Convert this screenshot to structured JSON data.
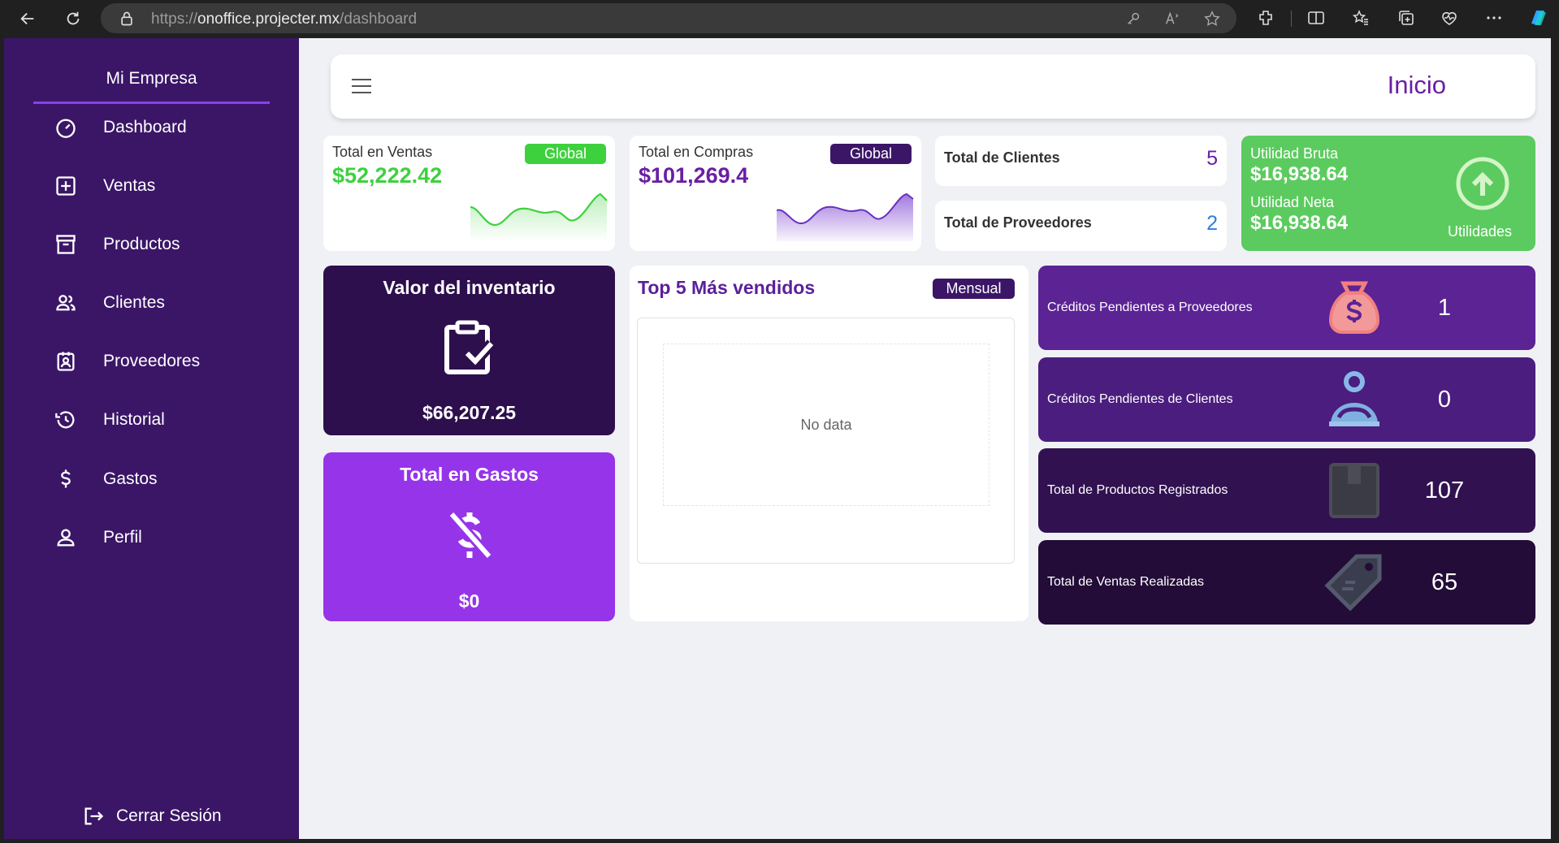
{
  "browser": {
    "url_scheme": "https://",
    "url_host": "onoffice.projecter.mx",
    "url_path": "/dashboard"
  },
  "sidebar": {
    "brand": "Mi Empresa",
    "items": [
      {
        "label": "Dashboard",
        "icon": "gauge-icon"
      },
      {
        "label": "Ventas",
        "icon": "plus-square-icon"
      },
      {
        "label": "Productos",
        "icon": "archive-box-icon"
      },
      {
        "label": "Clientes",
        "icon": "users-icon"
      },
      {
        "label": "Proveedores",
        "icon": "badge-id-icon"
      },
      {
        "label": "Historial",
        "icon": "history-icon"
      },
      {
        "label": "Gastos",
        "icon": "dollar-icon"
      },
      {
        "label": "Perfil",
        "icon": "user-icon"
      }
    ],
    "logout": "Cerrar Sesión"
  },
  "header": {
    "title": "Inicio"
  },
  "stats": {
    "ventas": {
      "label": "Total en Ventas",
      "badge": "Global",
      "value": "$52,222.42",
      "color": "#3ed13e"
    },
    "compras": {
      "label": "Total en Compras",
      "badge": "Global",
      "value": "$101,269.4",
      "color": "#6a1fa3"
    },
    "clientes": {
      "label": "Total de Clientes",
      "value": "5"
    },
    "proveedores": {
      "label": "Total de Proveedores",
      "value": "2"
    },
    "utilidad": {
      "bruta_label": "Utilidad Bruta",
      "bruta_value": "$16,938.64",
      "neta_label": "Utilidad Neta",
      "neta_value": "$16,938.64",
      "caption": "Utilidades"
    }
  },
  "inventario": {
    "title": "Valor del inventario",
    "value": "$66,207.25"
  },
  "gastos": {
    "title": "Total en Gastos",
    "value": "$0"
  },
  "top5": {
    "title": "Top 5 Más vendidos",
    "badge": "Mensual",
    "empty": "No data"
  },
  "right_cards": [
    {
      "label": "Créditos Pendientes a Proveedores",
      "value": "1",
      "icon": "money-bag-icon",
      "bg": "#5b2394"
    },
    {
      "label": "Créditos Pendientes de Clientes",
      "value": "0",
      "icon": "client-tray-icon",
      "bg": "#4a1d7e"
    },
    {
      "label": "Total de Productos Registrados",
      "value": "107",
      "icon": "box-icon",
      "bg": "#311150"
    },
    {
      "label": "Total de Ventas Realizadas",
      "value": "65",
      "icon": "price-tag-icon",
      "bg": "#230c38"
    }
  ],
  "colors": {
    "sidebar": "#3b1667",
    "accent": "#8b3ff0",
    "green": "#5ccb5f",
    "gastos": "#9634ea",
    "inventario": "#2d0f4d"
  }
}
